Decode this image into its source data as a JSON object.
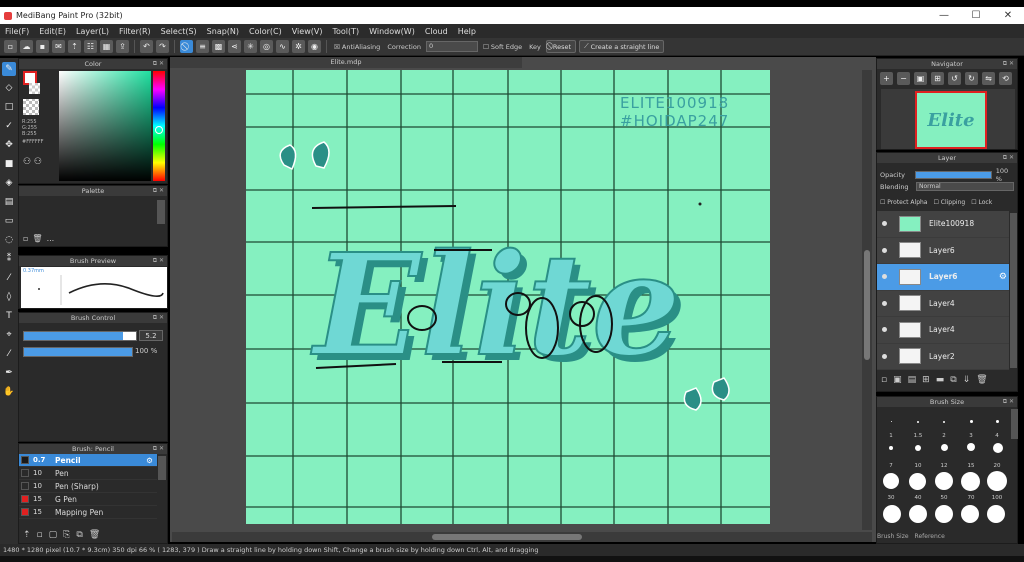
{
  "app": {
    "title": "MediBang Paint Pro (32bit)",
    "window_controls": [
      "—",
      "☐",
      "✕"
    ]
  },
  "menu": [
    "File(F)",
    "Edit(E)",
    "Layer(L)",
    "Filter(R)",
    "Select(S)",
    "Snap(N)",
    "Color(C)",
    "View(V)",
    "Tool(T)",
    "Window(W)",
    "Cloud",
    "Help"
  ],
  "toolbar": {
    "antialiasing_label": "AntiAliasing",
    "correction_label": "Correction",
    "correction_value": "0",
    "soft_edge_label": "Soft Edge",
    "key_label": "Key",
    "reset_label": "Reset",
    "straight_line_label": "Create a straight line"
  },
  "document": {
    "tab_title": "Elite.mdp"
  },
  "canvas_text": {
    "tag1": "ELITE100918",
    "tag2": "#HOIDAP247",
    "title_art": "Elite"
  },
  "color_panel": {
    "title": "Color",
    "r": "R:255",
    "g": "G:255",
    "b": "B:255",
    "hex": "#FFFFFF"
  },
  "palette_panel": {
    "title": "Palette",
    "more": "..."
  },
  "brush_preview": {
    "title": "Brush Preview",
    "size": "0.37mm"
  },
  "brush_control": {
    "title": "Brush Control",
    "size_value": "5.2",
    "opacity_value": "100 %",
    "size_fraction": 0.88,
    "opacity_fraction": 1.0
  },
  "brush_list": {
    "title": "Brush: Pencil",
    "items": [
      {
        "size": "0.7",
        "name": "Pencil",
        "color": "#1a1a1a",
        "selected": true
      },
      {
        "size": "10",
        "name": "Pen",
        "color": "#2a2a2a"
      },
      {
        "size": "10",
        "name": "Pen (Sharp)",
        "color": "#2a2a2a"
      },
      {
        "size": "15",
        "name": "G Pen",
        "color": "#e02020"
      },
      {
        "size": "15",
        "name": "Mapping Pen",
        "color": "#e02020"
      }
    ]
  },
  "navigator": {
    "title": "Navigator",
    "preview_text": "Elite"
  },
  "layer_panel": {
    "title": "Layer",
    "opacity_label": "Opacity",
    "opacity_value": "100 %",
    "blending_label": "Blending",
    "blending_value": "Normal",
    "protect_alpha": "Protect Alpha",
    "clipping": "Clipping",
    "lock": "Lock",
    "layers": [
      {
        "name": "Elite100918",
        "selected": false
      },
      {
        "name": "Layer6",
        "selected": false
      },
      {
        "name": "Layer6",
        "selected": true
      },
      {
        "name": "Layer4",
        "selected": false
      },
      {
        "name": "Layer4",
        "selected": false
      },
      {
        "name": "Layer2",
        "selected": false
      }
    ]
  },
  "brush_size_panel": {
    "title": "Brush Size",
    "row_labels": [
      [
        "1",
        "1.5",
        "2",
        "3",
        "4"
      ],
      [
        "7",
        "10",
        "12",
        "15",
        "20"
      ],
      [
        "30",
        "40",
        "50",
        "70",
        "100"
      ]
    ],
    "tab1": "Brush Size",
    "tab2": "Reference"
  },
  "status": {
    "text": "1480 * 1280 pixel  (10.7 * 9.3cm)  350 dpi  66 %  ( 1283, 379 )  Draw a straight line by holding down Shift, Change a brush size by holding down Ctrl, Alt, and dragging"
  },
  "colors": {
    "canvas_bg": "#85f0c0",
    "grid": "#1e4a34",
    "accent": "#3a8ad8",
    "letter_dark": "#2a8f86",
    "letter_light": "#6fd8d4"
  }
}
